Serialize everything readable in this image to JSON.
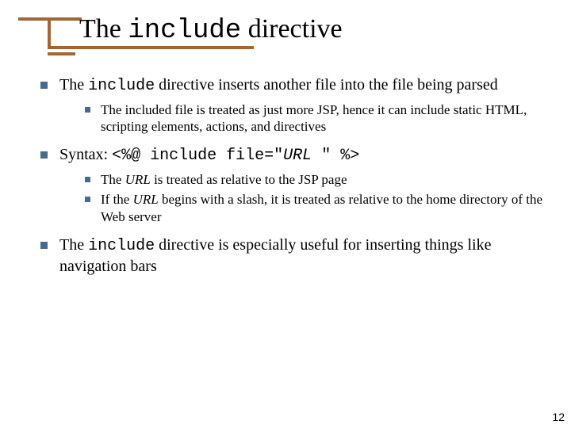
{
  "title": {
    "pre": "The ",
    "code": "include",
    "post": " directive"
  },
  "bullets": {
    "b1": {
      "t1": "The ",
      "code": "include",
      "t2": " directive inserts another file into the file being parsed",
      "sub1": "The included file is treated as just more JSP, hence it can include static HTML, scripting elements, actions, and directives"
    },
    "b2": {
      "t1": "Syntax:  ",
      "code1": "<%@ include file=\"",
      "url": "URL",
      "code2": " \" %>",
      "sub1_a": "The ",
      "sub1_url": "URL",
      "sub1_b": " is treated as relative to the JSP page",
      "sub2_a": "If the ",
      "sub2_url": "URL",
      "sub2_b": " begins with a slash, it is treated as relative to the home directory of the Web server"
    },
    "b3": {
      "t1": "The ",
      "code": "include",
      "t2": " directive is especially useful for inserting things like navigation bars"
    }
  },
  "page_number": "12"
}
